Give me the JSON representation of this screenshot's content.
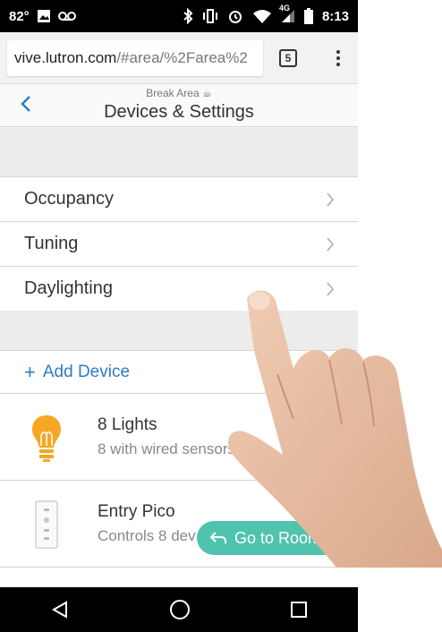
{
  "status_bar": {
    "temperature": "82°",
    "time": "8:13",
    "network": "4G",
    "icons": [
      "image-icon",
      "voicemail-icon",
      "bluetooth-icon",
      "vibrate-icon",
      "alarm-icon",
      "wifi-icon",
      "signal-icon",
      "battery-icon"
    ]
  },
  "browser": {
    "url_domain": "vive.lutron.com",
    "url_path": "/#area/%2Farea%2",
    "tab_count": "5"
  },
  "header": {
    "subtitle": "Break Area ☕",
    "title": "Devices & Settings"
  },
  "settings": {
    "items": [
      {
        "label": "Occupancy"
      },
      {
        "label": "Tuning"
      },
      {
        "label": "Daylighting"
      }
    ]
  },
  "devices": {
    "add_label": "Add Device",
    "items": [
      {
        "title": "8 Lights",
        "subtitle": "8 with wired sensors",
        "icon": "lightbulb-icon"
      },
      {
        "title": "Entry Pico",
        "subtitle": "Controls 8 dev",
        "icon": "pico-remote-icon"
      }
    ]
  },
  "goto_room": {
    "label": "Go to Room"
  },
  "colors": {
    "accent_blue": "#2c7cc7",
    "pill_teal": "#4fc3ad",
    "bulb_orange": "#f5a623"
  }
}
